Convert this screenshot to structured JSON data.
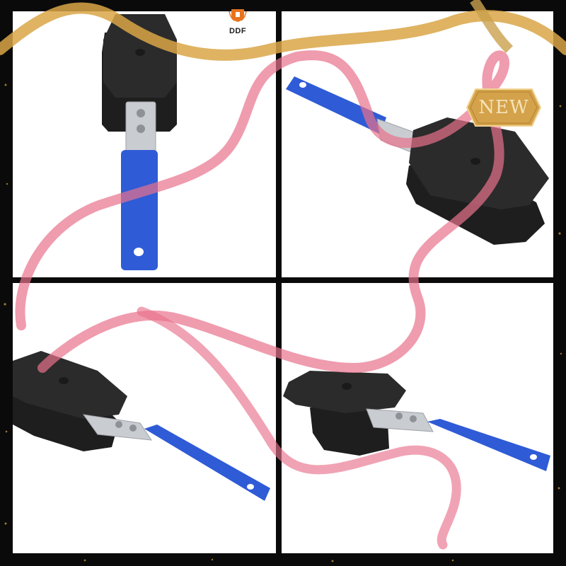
{
  "brand": {
    "logo_text": "DDF",
    "logo_icon": "crest-shield-icon"
  },
  "badge": {
    "text": "NEW"
  },
  "panels": [
    {
      "subject": "brake-caliper-piston-spreader"
    },
    {
      "subject": "brake-caliper-piston-spreader"
    },
    {
      "subject": "brake-caliper-piston-spreader"
    },
    {
      "subject": "brake-caliper-piston-spreader"
    }
  ],
  "colors": {
    "frame": "#0a0a0a",
    "gold_ribbon": "#d9a646",
    "pink_ribbon": "#e8728c",
    "tool_black": "#2a2a2a",
    "handle_blue": "#2f5bd6",
    "steel": "#c9ccd1",
    "badge_gold": "#d4a24a"
  }
}
